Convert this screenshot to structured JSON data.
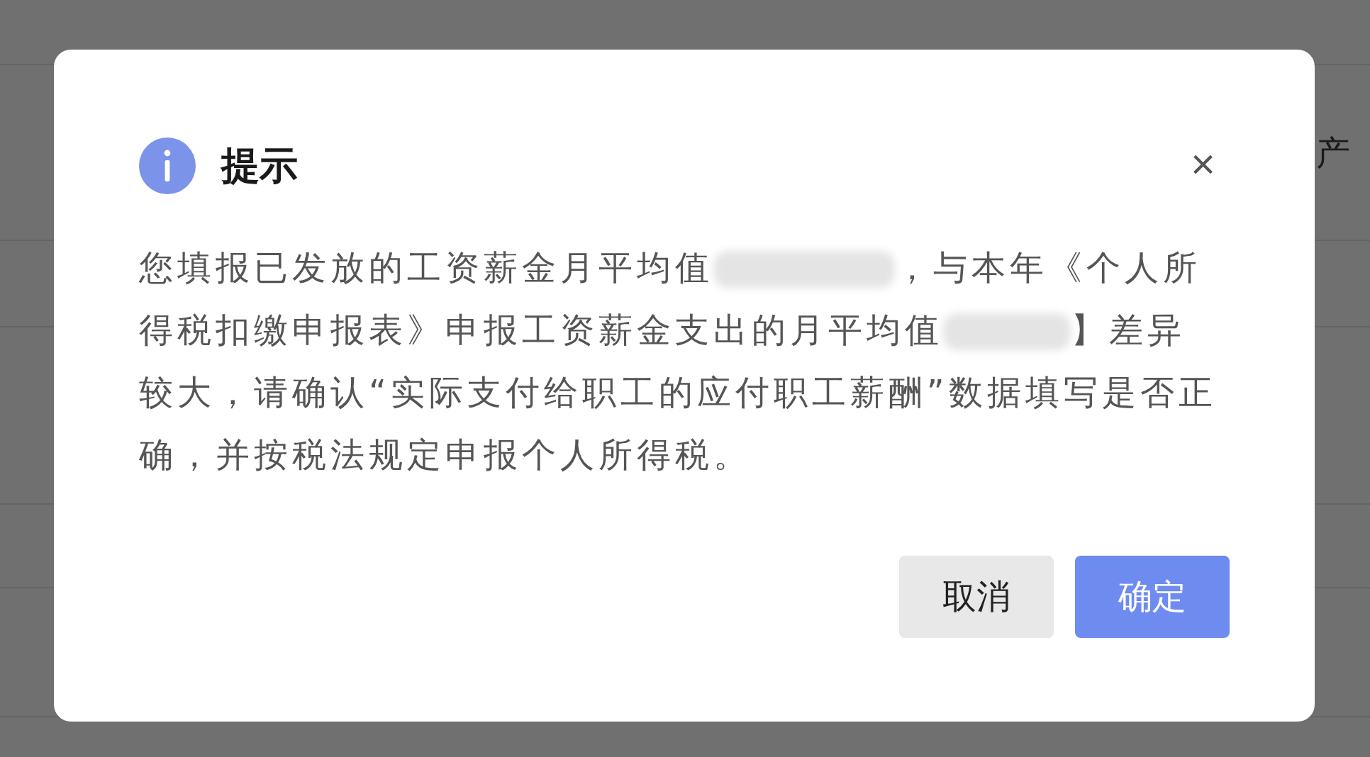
{
  "background": {
    "rows": [
      {
        "text": ""
      },
      {
        "text": "产"
      }
    ]
  },
  "dialog": {
    "title": "提示",
    "message": [
      {
        "kind": "text",
        "text": "您填报已发放的工资薪金月平均值"
      },
      {
        "kind": "redacted-wide"
      },
      {
        "kind": "text",
        "text": "，与本年《个人所得税扣缴申报表》申报工资薪金支出的月平均值"
      },
      {
        "kind": "redacted-narrow"
      },
      {
        "kind": "text",
        "text": "】差异较大，请确认“实际支付给职工的应付职工薪酬”数据填写是否正确，并按税法规定申报个人所得税。"
      }
    ],
    "close": "×",
    "buttons": [
      {
        "label": "取消",
        "kind": "secondary"
      },
      {
        "label": "确定",
        "kind": "primary"
      }
    ]
  }
}
